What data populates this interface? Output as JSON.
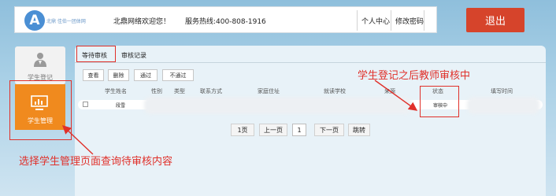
{
  "header": {
    "logo_letter": "A",
    "logo_text": "北鼎 佳伯一团体网",
    "welcome": "北鼎网络欢迎您！",
    "hotline": "服务热线:400-808-1916",
    "links": [
      "个人中心",
      "修改密码"
    ],
    "logout": "退出"
  },
  "sidebar": {
    "items": [
      {
        "label": "学生登记",
        "icon": "student-register-icon"
      },
      {
        "label": "学生管理",
        "icon": "monitor-chart-icon",
        "active": true
      }
    ]
  },
  "main": {
    "tabs": [
      "等待审核",
      "审核记录"
    ],
    "toolbar": [
      "查看",
      "删除",
      "通过",
      "不通过"
    ],
    "columns": [
      "学生姓名",
      "性别",
      "类型",
      "联系方式",
      "家庭住址",
      "就读学校",
      "来源",
      "状态",
      "填写时间"
    ],
    "rows": [
      {
        "name_partial": "段雪",
        "status": "审核中"
      }
    ],
    "pagination": {
      "first": "1页",
      "prev": "上一页",
      "current": "1",
      "next": "下一页",
      "jump": "跳转"
    }
  },
  "annotations": {
    "top": "学生登记之后教师审核中",
    "bottom": "选择学生管理页面查询待审核内容"
  },
  "colors": {
    "accent_orange": "#f08a1e",
    "logout_red": "#d6442b",
    "annotation_red": "#e0302a",
    "background": "#a9d0e6"
  }
}
